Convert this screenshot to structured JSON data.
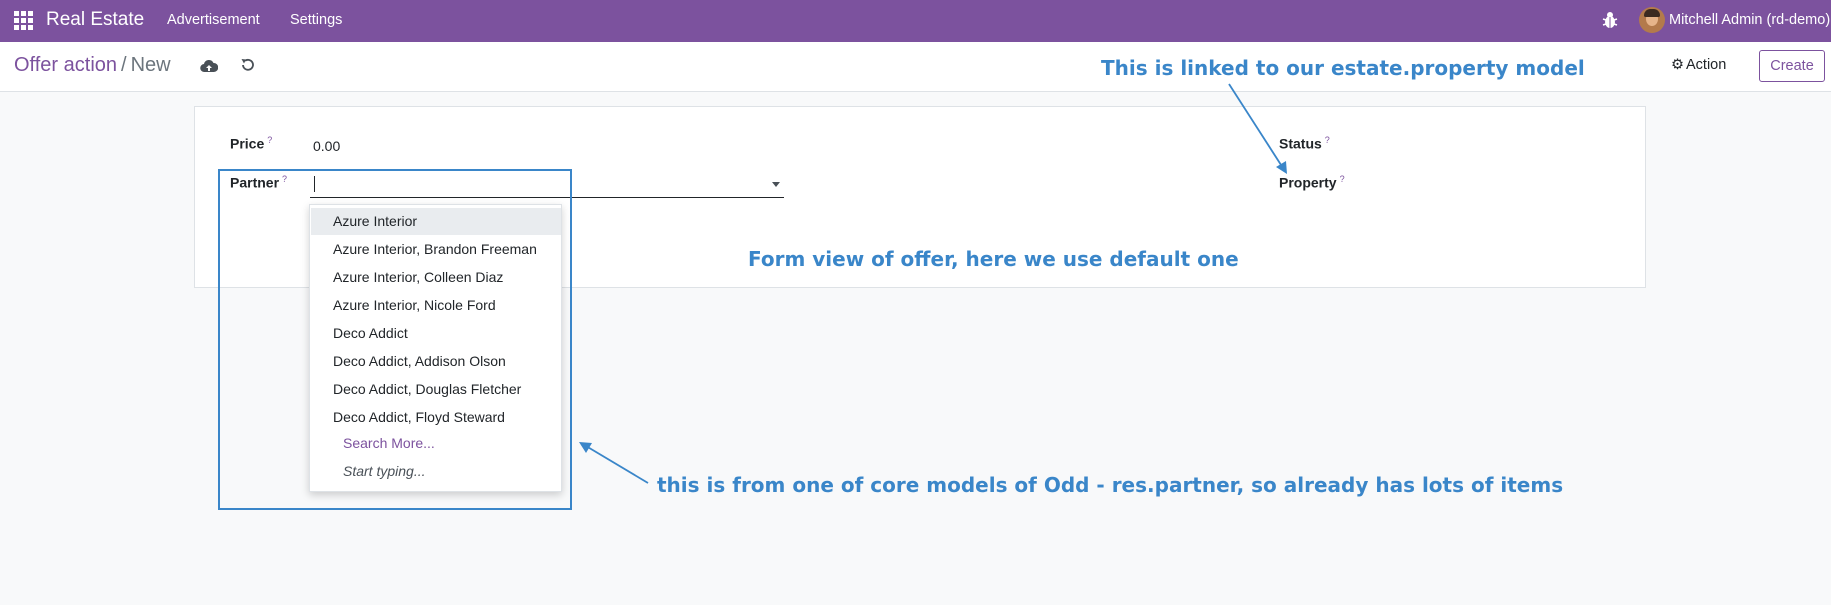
{
  "navbar": {
    "app_title": "Real Estate",
    "menus": [
      "Advertisement",
      "Settings"
    ],
    "user": "Mitchell Admin (rd-demo)",
    "apps_icon": "grid-icon",
    "debug_icon": "bug-icon",
    "color": "#7c529e"
  },
  "control_panel": {
    "breadcrumb_parent": "Offer action",
    "breadcrumb_separator": "/",
    "breadcrumb_current": "New",
    "save_icon": "cloud-upload-icon",
    "discard_icon": "undo-icon",
    "action_label": "Action",
    "create_label": "Create"
  },
  "form": {
    "fields": {
      "price": {
        "label": "Price",
        "help": "?",
        "value": "0.00"
      },
      "partner": {
        "label": "Partner",
        "help": "?",
        "value": ""
      },
      "status": {
        "label": "Status",
        "help": "?"
      },
      "property": {
        "label": "Property",
        "help": "?"
      }
    }
  },
  "dropdown": {
    "items": [
      "Azure Interior",
      "Azure Interior, Brandon Freeman",
      "Azure Interior, Colleen Diaz",
      "Azure Interior, Nicole Ford",
      "Deco Addict",
      "Deco Addict, Addison Olson",
      "Deco Addict, Douglas Fletcher",
      "Deco Addict, Floyd Steward"
    ],
    "search_more": "Search More...",
    "start_typing": "Start typing..."
  },
  "annotations": {
    "top": "This is linked to our estate.property model",
    "middle": "Form view of offer, here we use default one",
    "bottom": "this is from one of core models of Odd - res.partner, so already has lots of items",
    "color": "#3a86c9"
  }
}
